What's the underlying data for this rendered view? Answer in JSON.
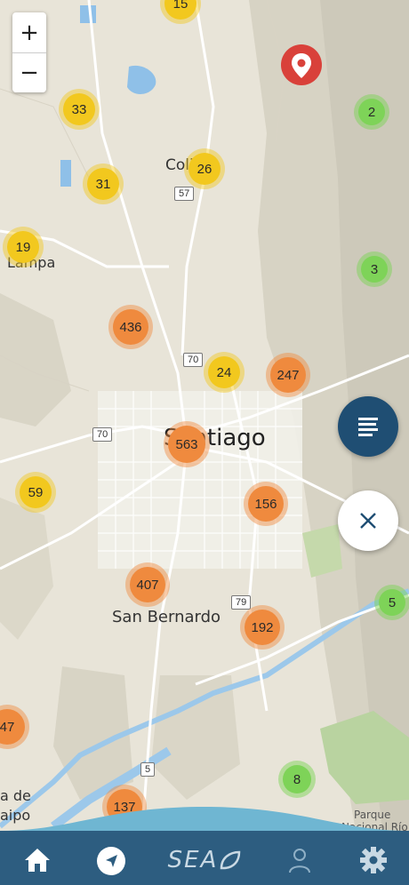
{
  "map": {
    "zoom_in": "+",
    "zoom_out": "−",
    "place_labels": {
      "colina": "Colina",
      "lampa": "Lampa",
      "santiago": "Santiago",
      "san_bernardo": "San Bernardo",
      "parque": "Parque",
      "nacional_rio": "Nacional Río",
      "isla_de": "a de",
      "maipo": "aipo"
    },
    "route_shields": [
      "57",
      "70",
      "70",
      "79",
      "5"
    ],
    "clusters": [
      {
        "count": "15",
        "tier": "yellow"
      },
      {
        "count": "33",
        "tier": "yellow"
      },
      {
        "count": "31",
        "tier": "yellow"
      },
      {
        "count": "26",
        "tier": "yellow"
      },
      {
        "count": "19",
        "tier": "yellow"
      },
      {
        "count": "436",
        "tier": "orange"
      },
      {
        "count": "24",
        "tier": "yellow"
      },
      {
        "count": "247",
        "tier": "orange"
      },
      {
        "count": "563",
        "tier": "orange"
      },
      {
        "count": "59",
        "tier": "yellow"
      },
      {
        "count": "156",
        "tier": "orange"
      },
      {
        "count": "407",
        "tier": "orange"
      },
      {
        "count": "192",
        "tier": "orange"
      },
      {
        "count": "47",
        "tier": "orange"
      },
      {
        "count": "137",
        "tier": "orange"
      },
      {
        "count": "2",
        "tier": "green"
      },
      {
        "count": "3",
        "tier": "green"
      },
      {
        "count": "5",
        "tier": "green"
      },
      {
        "count": "8",
        "tier": "green"
      }
    ],
    "marker_icon": "map-pin-icon"
  },
  "fabs": {
    "list_icon": "list-icon",
    "close_icon": "close-icon"
  },
  "bottom_nav": {
    "brand": "SEA",
    "items": [
      "home-icon",
      "navigate-icon",
      "brand-logo",
      "person-icon",
      "gear-icon"
    ]
  },
  "colors": {
    "yellow": "#f2c81e",
    "orange": "#ef8a3e",
    "green": "#7ed358",
    "nav_bg": "#2d5d80",
    "fab_dark": "#1f4e73",
    "marker": "#d9413a"
  }
}
